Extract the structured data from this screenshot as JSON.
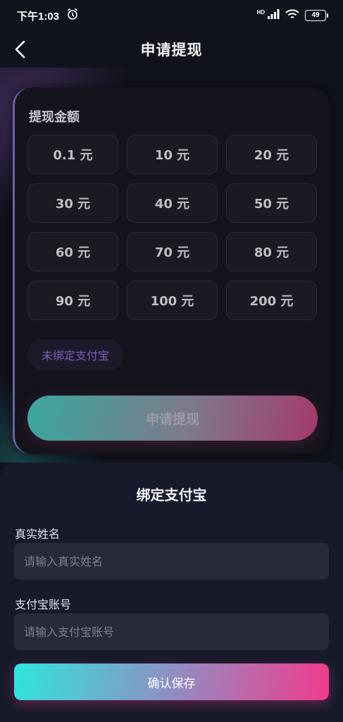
{
  "status_bar": {
    "time": "下午1:03",
    "network_label": "HD",
    "battery": "49",
    "icons": [
      "alarm-icon",
      "signal-icon",
      "wifi-icon",
      "battery-icon"
    ]
  },
  "nav": {
    "title": "申请提现",
    "back_icon": "chevron-left-icon"
  },
  "withdraw": {
    "section_label": "提现金额",
    "amounts": [
      "0.1 元",
      "10 元",
      "20 元",
      "30 元",
      "40 元",
      "50 元",
      "60 元",
      "70 元",
      "80 元",
      "90 元",
      "100 元",
      "200 元"
    ],
    "unbound_label": "未绑定支付宝",
    "apply_label": "申请提现"
  },
  "bind": {
    "title": "绑定支付宝",
    "name_label": "真实姓名",
    "name_placeholder": "请输入真实姓名",
    "account_label": "支付宝账号",
    "account_placeholder": "请输入支付宝账号",
    "save_label": "确认保存"
  },
  "colors": {
    "background": "#11131c",
    "card": "#14141c",
    "accent_cyan": "#2fe6dc",
    "accent_pink": "#f23a8c",
    "accent_purple": "#7a5cc0"
  }
}
